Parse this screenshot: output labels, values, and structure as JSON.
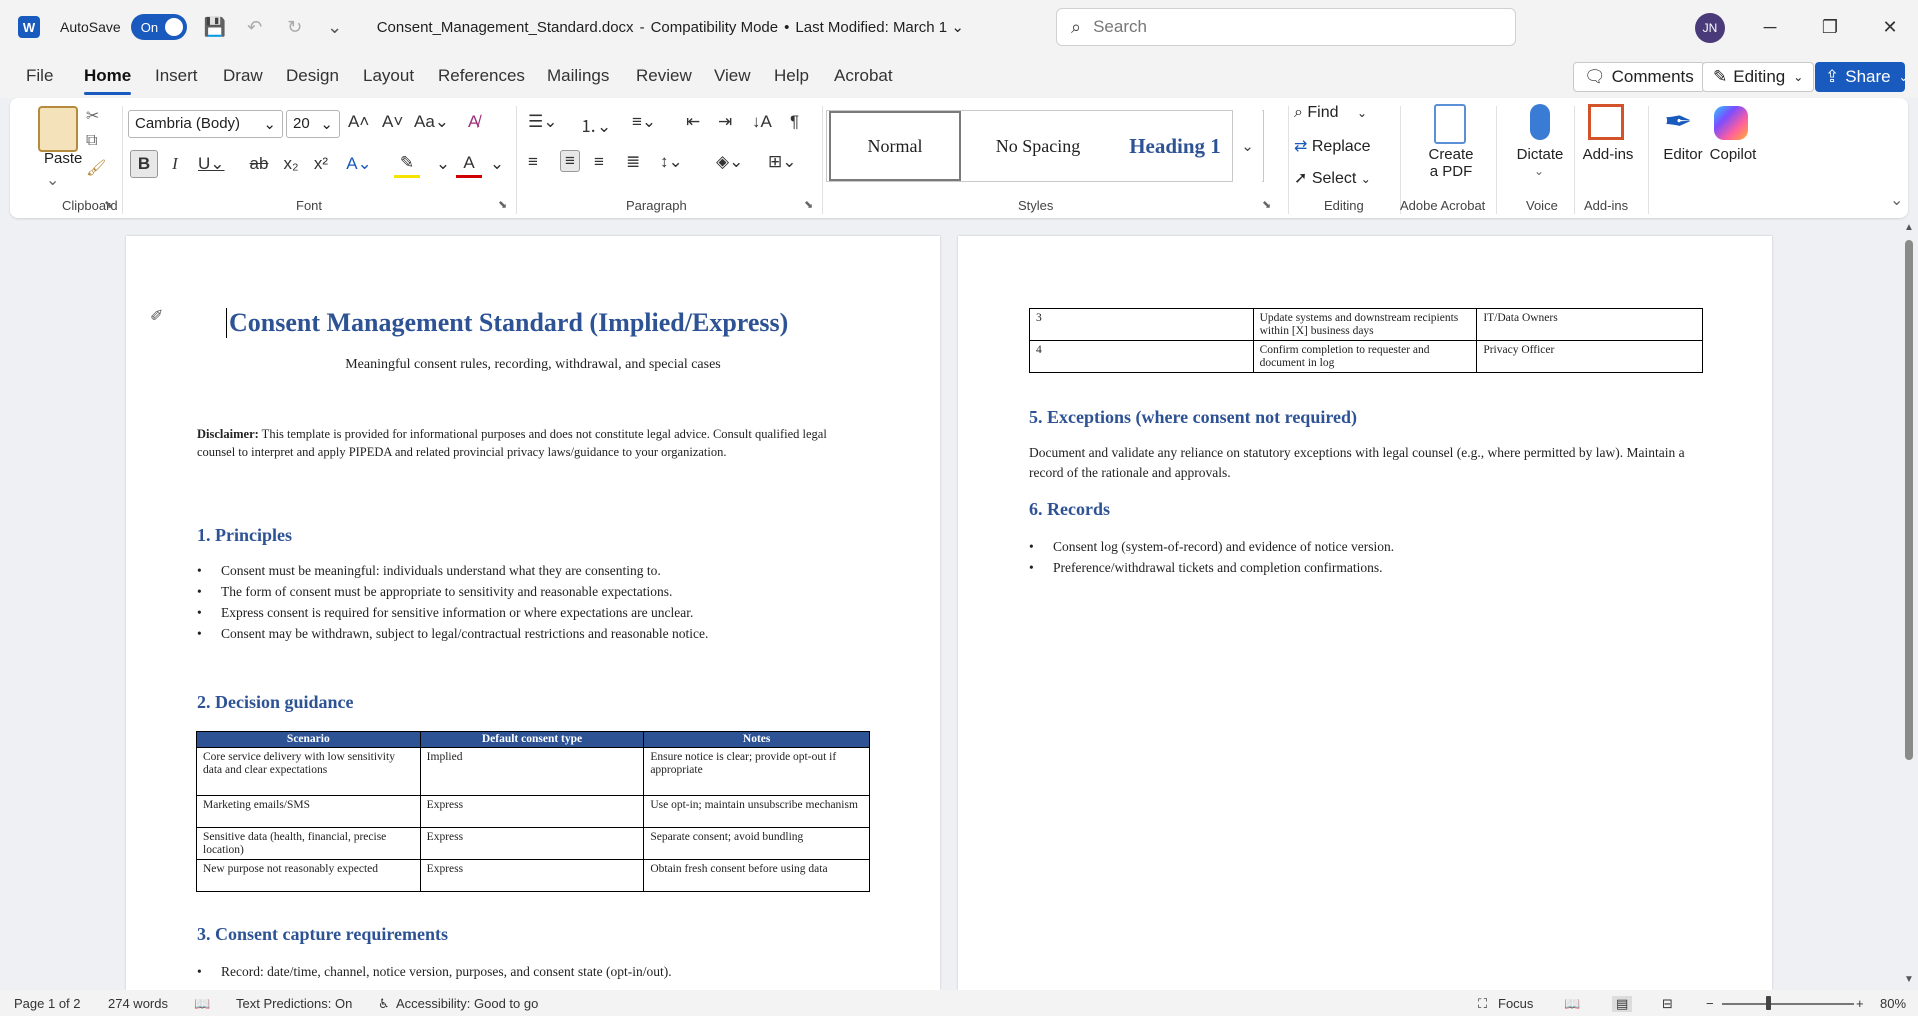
{
  "titlebar": {
    "autosave_label": "AutoSave",
    "autosave_state": "On",
    "filename": "Consent_Management_Standard.docx",
    "mode": "Compatibility Mode",
    "modified": "Last Modified: March 1",
    "search_placeholder": "Search",
    "user_initials": "JN"
  },
  "menu": {
    "tabs": [
      "File",
      "Home",
      "Insert",
      "Draw",
      "Design",
      "Layout",
      "References",
      "Mailings",
      "Review",
      "View",
      "Help",
      "Acrobat"
    ],
    "comments_label": "Comments",
    "editing_label": "Editing",
    "share_label": "Share"
  },
  "ribbon": {
    "paste_label": "Paste",
    "font_name": "Cambria (Body)",
    "font_size": "20",
    "styles": [
      "Normal",
      "No Spacing",
      "Heading 1"
    ],
    "find_label": "Find",
    "replace_label": "Replace",
    "select_label": "Select",
    "create_pdf_line1": "Create",
    "create_pdf_line2": "a PDF",
    "dictate_label": "Dictate",
    "addins_label": "Add-ins",
    "editor_label": "Editor",
    "copilot_label": "Copilot",
    "groups": {
      "clipboard": "Clipboard",
      "font": "Font",
      "paragraph": "Paragraph",
      "styles": "Styles",
      "editing": "Editing",
      "adobe": "Adobe Acrobat",
      "voice": "Voice",
      "addins": "Add-ins"
    }
  },
  "document": {
    "title": "Consent Management Standard (Implied/Express)",
    "subtitle": "Meaningful consent rules, recording, withdrawal, and special cases",
    "disclaimer_label": "Disclaimer:",
    "disclaimer_text": " This template is provided for informational purposes and does not constitute legal advice. Consult qualified legal counsel to interpret and apply PIPEDA and related provincial privacy laws/guidance to your organization.",
    "s1_heading": "1. Principles",
    "s1_bullets": [
      "Consent must be meaningful: individuals understand what they are consenting to.",
      "The form of consent must be appropriate to sensitivity and reasonable expectations.",
      "Express consent is required for sensitive information or where expectations are unclear.",
      "Consent may be withdrawn, subject to legal/contractual restrictions and reasonable notice."
    ],
    "s2_heading": "2. Decision guidance",
    "s2_table": {
      "headers": [
        "Scenario",
        "Default consent type",
        "Notes"
      ],
      "rows": [
        [
          "Core service delivery with low sensitivity data and clear expectations",
          "Implied",
          "Ensure notice is clear; provide opt-out if appropriate"
        ],
        [
          "Marketing emails/SMS",
          "Express",
          "Use opt-in; maintain unsubscribe mechanism"
        ],
        [
          "Sensitive data (health, financial, precise location)",
          "Express",
          "Separate consent; avoid bundling"
        ],
        [
          "New purpose not reasonably expected",
          "Express",
          "Obtain fresh consent before using data"
        ]
      ]
    },
    "s3_heading": "3. Consent capture requirements",
    "s3_bullets": [
      "Record: date/time, channel, notice version, purposes, and consent state (opt-in/out)."
    ],
    "p2_table": {
      "rows": [
        [
          "3",
          "Update systems and downstream recipients within [X] business days",
          "IT/Data Owners"
        ],
        [
          "4",
          "Confirm completion to requester and document in log",
          "Privacy Officer"
        ]
      ]
    },
    "s5_heading": "5. Exceptions (where consent not required)",
    "s5_text": "Document and validate any reliance on statutory exceptions with legal counsel (e.g., where permitted by law). Maintain a record of the rationale and approvals.",
    "s6_heading": "6. Records",
    "s6_bullets": [
      "Consent log (system-of-record) and evidence of notice version.",
      "Preference/withdrawal tickets and completion confirmations."
    ]
  },
  "status": {
    "page": "Page 1 of 2",
    "words": "274 words",
    "text_predictions": "Text Predictions: On",
    "accessibility": "Accessibility: Good to go",
    "focus": "Focus",
    "zoom": "80%"
  },
  "colors": {
    "accent": "#185abd",
    "heading": "#2e5395"
  }
}
